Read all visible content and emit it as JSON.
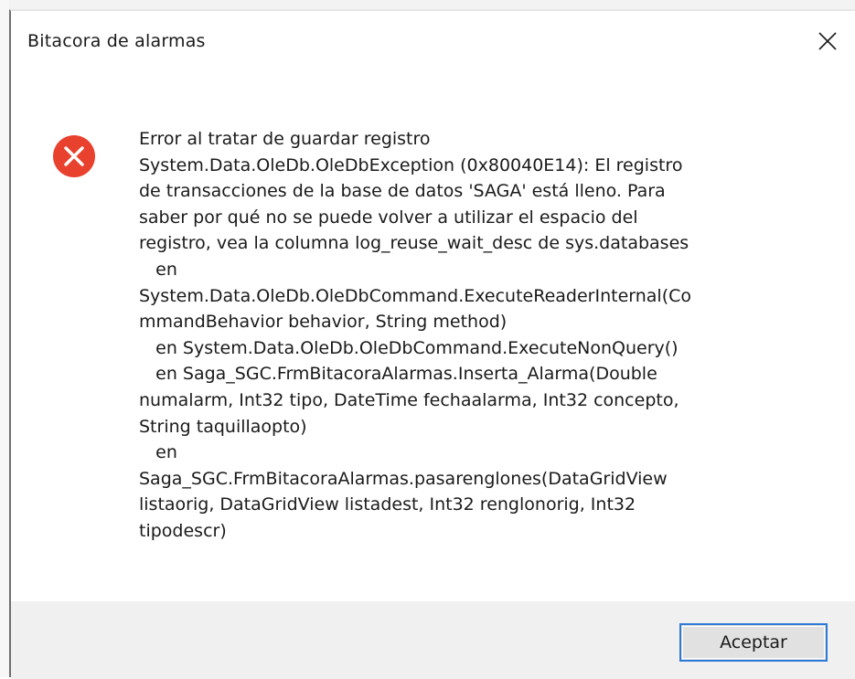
{
  "window": {
    "title": "Bitacora de alarmas",
    "close_icon": "close-icon"
  },
  "message": {
    "icon": "error-icon",
    "icon_color": "#e8412e",
    "lines": [
      "Error al tratar de guardar registro",
      "System.Data.OleDb.OleDbException (0x80040E14): El registro",
      "de transacciones de la base de datos 'SAGA' está lleno. Para",
      "saber por qué no se puede volver a utilizar el espacio del",
      "registro, vea la columna log_reuse_wait_desc de sys.databases",
      "   en",
      "System.Data.OleDb.OleDbCommand.ExecuteReaderInternal(Co",
      "mmandBehavior behavior, String method)",
      "   en System.Data.OleDb.OleDbCommand.ExecuteNonQuery()",
      "   en Saga_SGC.FrmBitacoraAlarmas.Inserta_Alarma(Double",
      "numalarm, Int32 tipo, DateTime fechaalarma, Int32 concepto,",
      "String taquillaopto)",
      "   en",
      "Saga_SGC.FrmBitacoraAlarmas.pasarenglones(DataGridView",
      "listaorig, DataGridView listadest, Int32 renglonorig, Int32",
      "tipodescr)"
    ]
  },
  "footer": {
    "ok_label": "Aceptar",
    "accent": "#2e7bd6"
  }
}
